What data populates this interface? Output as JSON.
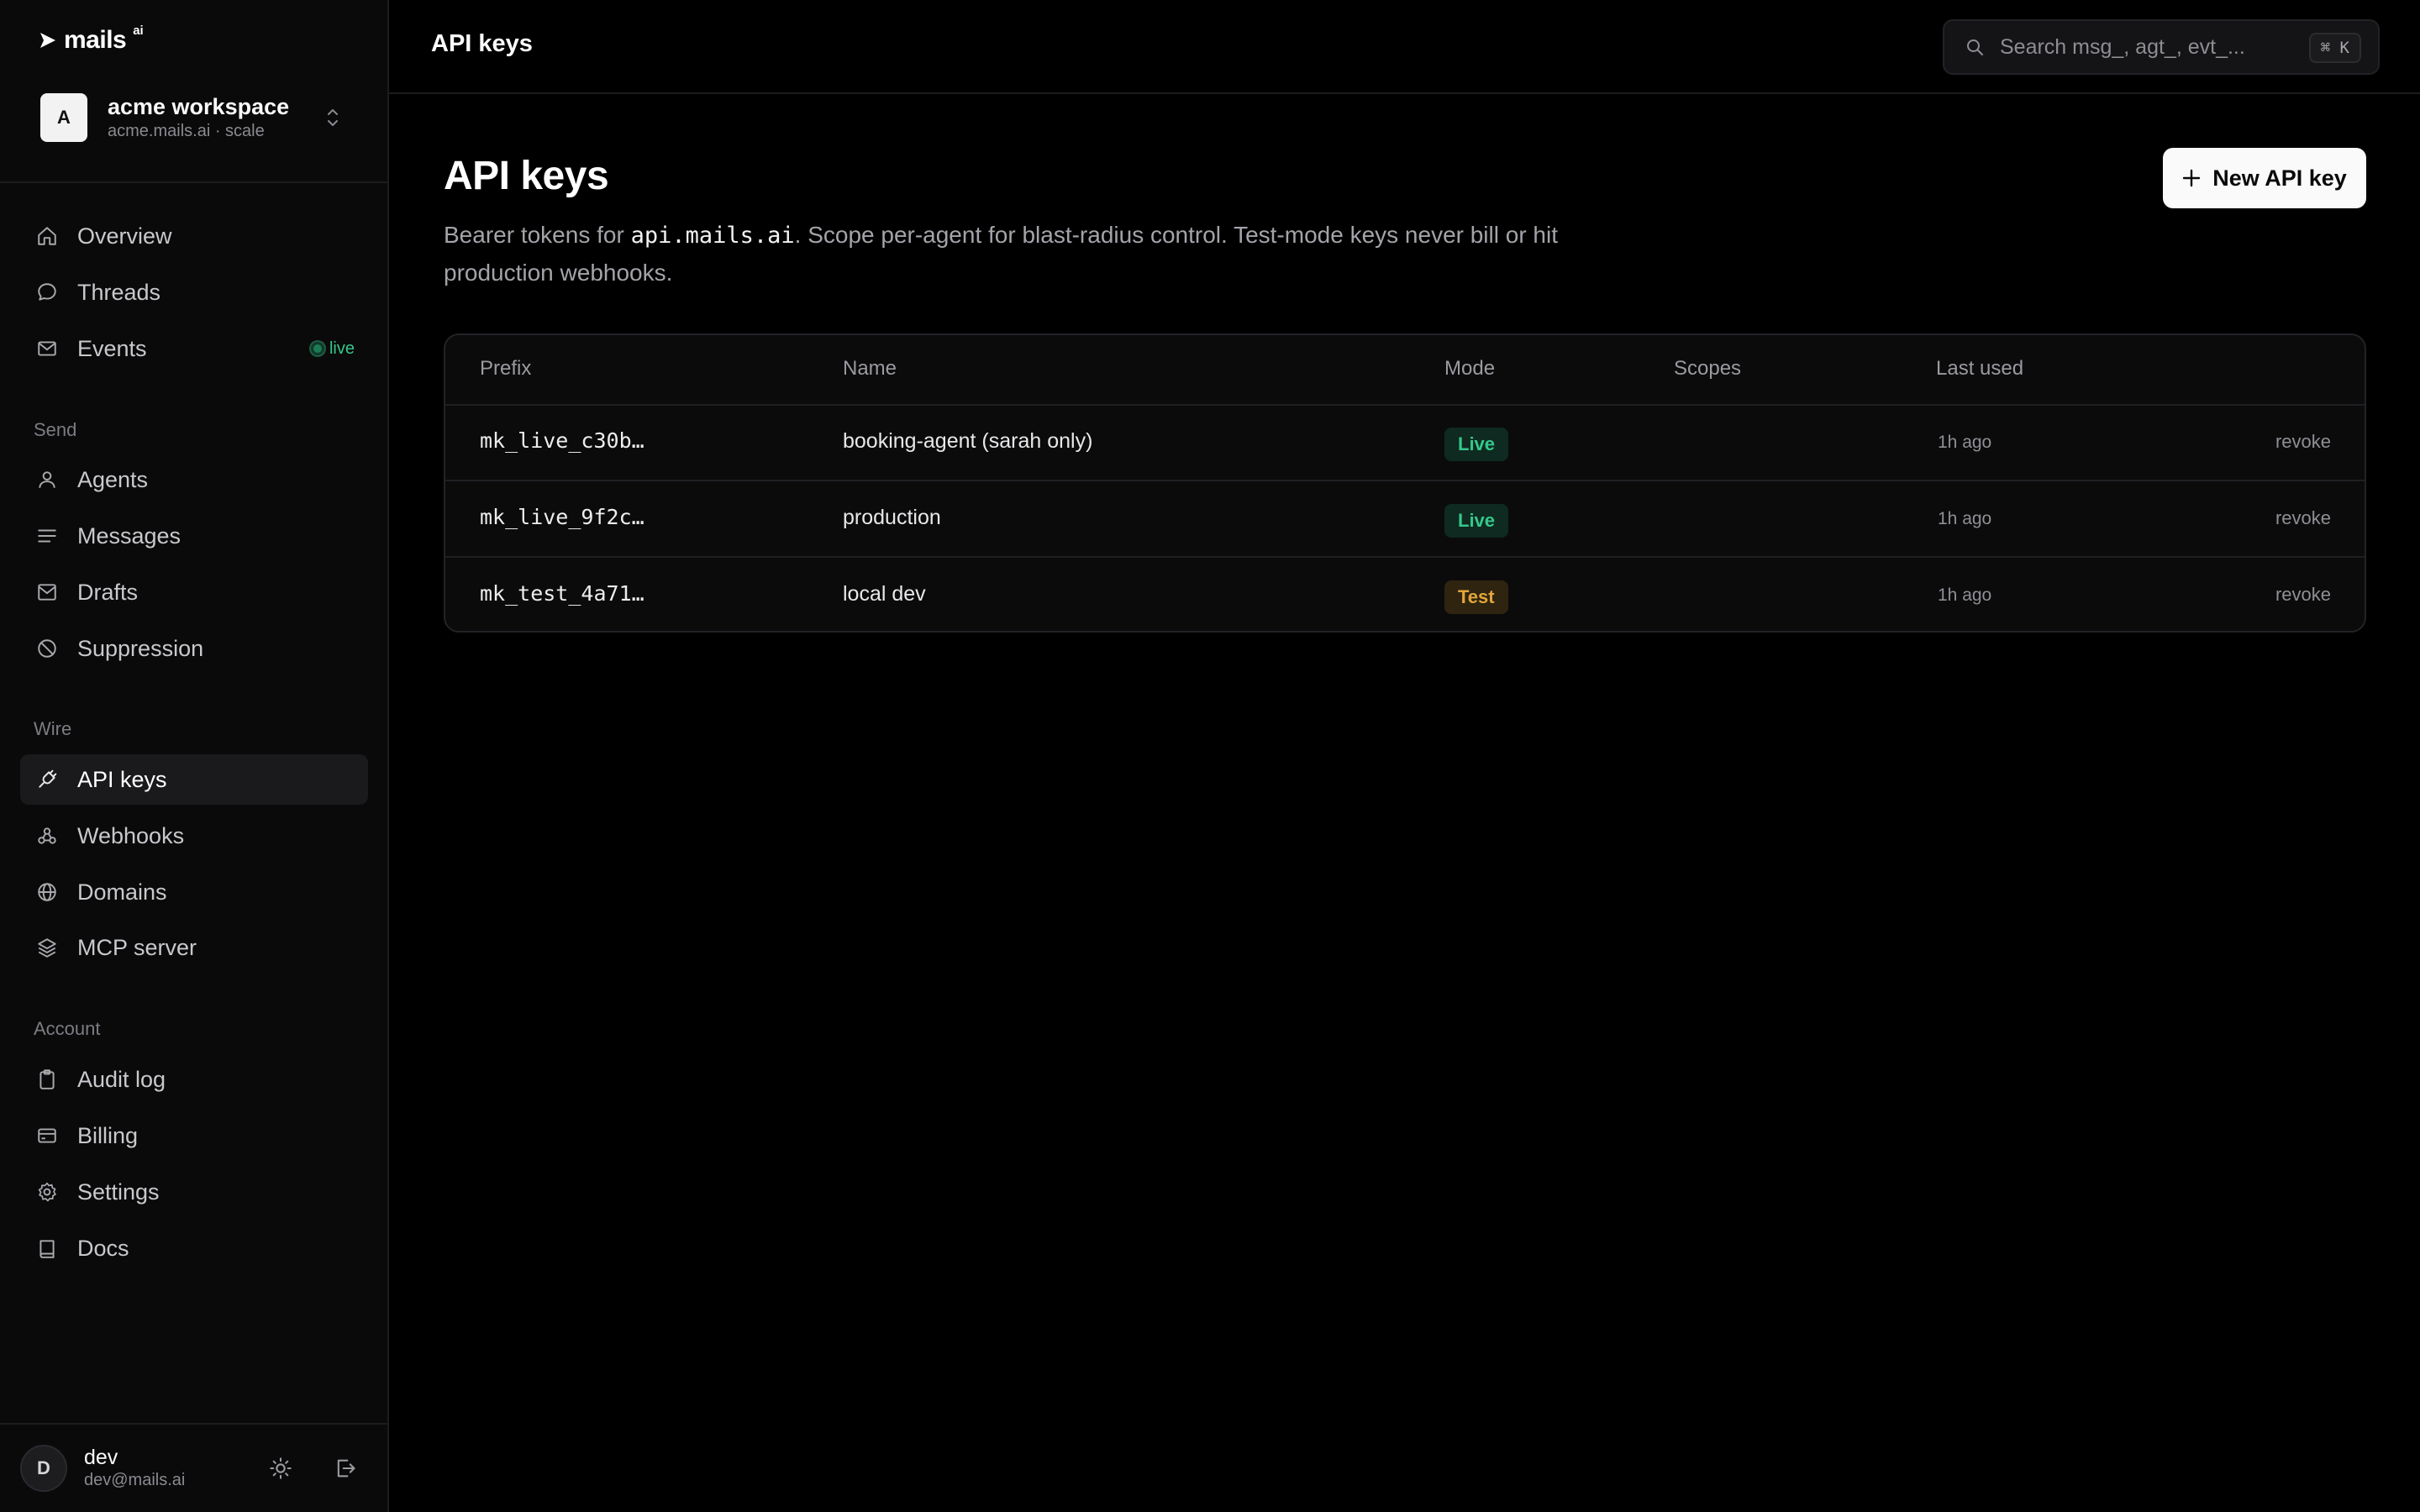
{
  "app": {
    "logo_text": "mails",
    "logo_sup": "ai"
  },
  "workspace": {
    "initial": "A",
    "name": "acme workspace",
    "subtitle": "acme.mails.ai · scale"
  },
  "sidebar": {
    "items_top": [
      {
        "label": "Overview",
        "icon": "home-icon"
      },
      {
        "label": "Threads",
        "icon": "chat-icon"
      },
      {
        "label": "Events",
        "icon": "mail-icon",
        "badge": "live"
      }
    ],
    "section_send": "Send",
    "items_send": [
      {
        "label": "Agents",
        "icon": "user-icon"
      },
      {
        "label": "Messages",
        "icon": "lines-icon"
      },
      {
        "label": "Drafts",
        "icon": "draft-mail-icon"
      },
      {
        "label": "Suppression",
        "icon": "ban-icon"
      }
    ],
    "section_wire": "Wire",
    "items_wire": [
      {
        "label": "API keys",
        "icon": "plug-icon",
        "active": true
      },
      {
        "label": "Webhooks",
        "icon": "webhook-icon"
      },
      {
        "label": "Domains",
        "icon": "globe-icon"
      },
      {
        "label": "MCP server",
        "icon": "layers-icon"
      }
    ],
    "section_account": "Account",
    "items_account": [
      {
        "label": "Audit log",
        "icon": "clipboard-icon"
      },
      {
        "label": "Billing",
        "icon": "card-icon"
      },
      {
        "label": "Settings",
        "icon": "gear-icon"
      },
      {
        "label": "Docs",
        "icon": "book-icon"
      }
    ]
  },
  "user": {
    "initial": "D",
    "name": "dev",
    "email": "dev@mails.ai"
  },
  "topbar": {
    "title": "API keys",
    "search_placeholder": "Search msg_, agt_, evt_...",
    "shortcut": "⌘ K"
  },
  "page": {
    "title": "API keys",
    "desc_before": "Bearer tokens for ",
    "desc_code": "api.mails.ai",
    "desc_after": ". Scope per-agent for blast-radius control. Test-mode keys never bill or hit production webhooks.",
    "new_button": "New API key"
  },
  "table": {
    "headers": [
      "Prefix",
      "Name",
      "Mode",
      "Scopes",
      "Last used"
    ],
    "rows": [
      {
        "prefix": "mk_live_c30b…",
        "name": "booking-agent (sarah only)",
        "mode": "Live",
        "scopes": "",
        "last_used": "1h ago",
        "action": "revoke"
      },
      {
        "prefix": "mk_live_9f2c…",
        "name": "production",
        "mode": "Live",
        "scopes": "",
        "last_used": "1h ago",
        "action": "revoke"
      },
      {
        "prefix": "mk_test_4a71…",
        "name": "local dev",
        "mode": "Test",
        "scopes": "",
        "last_used": "1h ago",
        "action": "revoke"
      }
    ]
  },
  "colors": {
    "background": "#000000",
    "sidebar": "#0a0a0b",
    "live_badge_text": "#34c88c",
    "test_badge_text": "#e3a63a",
    "primary_button": "#fafafa"
  }
}
